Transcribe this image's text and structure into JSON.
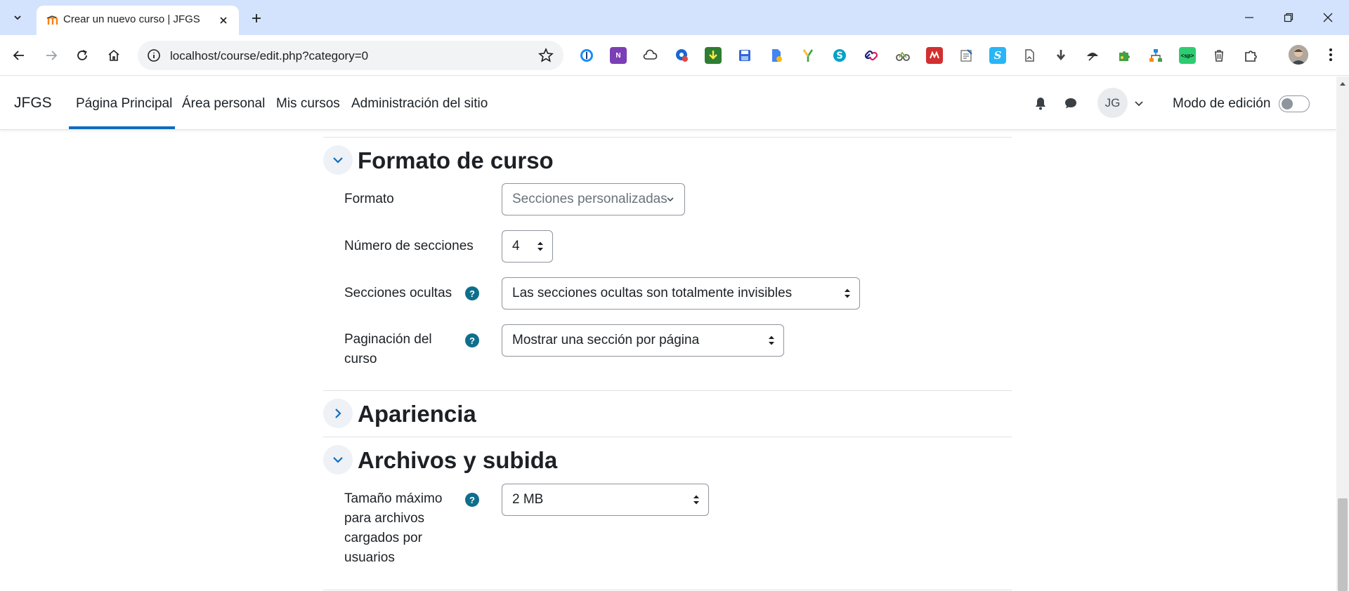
{
  "browser": {
    "tab_title": "Crear un nuevo curso | JFGS",
    "url": "localhost/course/edit.php?category=0"
  },
  "navbar": {
    "brand": "JFGS",
    "links": [
      "Página Principal",
      "Área personal",
      "Mis cursos",
      "Administración del sitio"
    ],
    "active_link": "Página Principal",
    "user_initials": "JG",
    "edit_mode_label": "Modo de edición",
    "edit_mode_on": false
  },
  "sections": {
    "course_format": {
      "title": "Formato de curso",
      "expanded": true,
      "fields": {
        "format": {
          "label": "Formato",
          "value": "Secciones personalizadas"
        },
        "num_sections": {
          "label": "Número de secciones",
          "value": "4"
        },
        "hidden_sections": {
          "label": "Secciones ocultas",
          "value": "Las secciones ocultas son totalmente invisibles"
        },
        "pagination": {
          "label": "Paginación del curso",
          "value": "Mostrar una sección por página"
        }
      }
    },
    "appearance": {
      "title": "Apariencia",
      "expanded": false
    },
    "files": {
      "title": "Archivos y subida",
      "expanded": true,
      "fields": {
        "max_upload": {
          "label": "Tamaño máximo para archivos cargados por usuarios",
          "value": "2 MB"
        }
      }
    }
  },
  "colors": {
    "accent": "#0f6cbf",
    "help_icon": "#0f6e8c",
    "tabstrip": "#d3e3fd"
  },
  "icons": {
    "help": "?",
    "extensions": [
      "1password-icon",
      "onenote-icon",
      "cloud-icon",
      "badge-icon",
      "download-ext-icon",
      "save-icon",
      "doc-ext-icon",
      "y-icon",
      "s-icon",
      "link-icon",
      "bike-icon",
      "mendeley-icon",
      "note-icon",
      "s2-icon",
      "file-icon",
      "download-icon",
      "umbrella-icon",
      "puzzle-green-icon",
      "tree-icon",
      "sp-icon",
      "trash-icon",
      "extensions-icon"
    ]
  }
}
